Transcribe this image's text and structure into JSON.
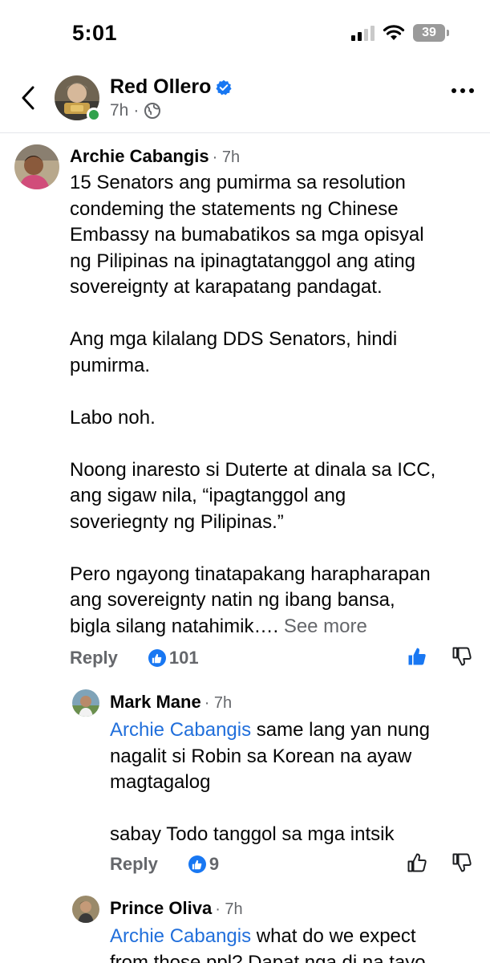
{
  "status_bar": {
    "time": "5:01",
    "battery": "39"
  },
  "header": {
    "name": "Red Ollero",
    "time": "7h",
    "dot": "·"
  },
  "comments": [
    {
      "name": "Archie Cabangis",
      "time": "· 7h",
      "paragraphs": [
        "15 Senators ang pumirma sa resolution",
        "condeming the  statements ng Chinese",
        "Embassy na bumabatikos sa mga opisyal",
        "ng Pilipinas na ipinagtatanggol ang ating",
        "sovereignty at karapatang pandagat.",
        "",
        "Ang mga kilalang DDS Senators, hindi",
        "pumirma.",
        "",
        "Labo noh.",
        "",
        "Noong inaresto si Duterte at dinala sa ICC,",
        "ang sigaw nila, “ipagtanggol ang",
        "soveriegnty ng Pilipinas.”",
        "",
        "Pero ngayong tinatapakang harapharapan",
        "ang sovereignty natin ng ibang bansa,",
        "bigla silang natahimik…."
      ],
      "see_more": "See more",
      "reply_label": "Reply",
      "like_count": "101"
    },
    {
      "name": "Mark Mane",
      "time": "· 7h",
      "mention": "Archie Cabangis",
      "lines": [
        " same lang yan nung",
        "nagalit si Robin sa Korean na ayaw",
        "magtagalog",
        "",
        "sabay Todo tanggol sa mga intsik"
      ],
      "reply_label": "Reply",
      "like_count": "9"
    },
    {
      "name": "Prince Oliva",
      "time": "· 7h",
      "mention": "Archie Cabangis",
      "lines": [
        " what do we expect",
        "from those ppl? Dapat nga di na tayo"
      ]
    }
  ]
}
